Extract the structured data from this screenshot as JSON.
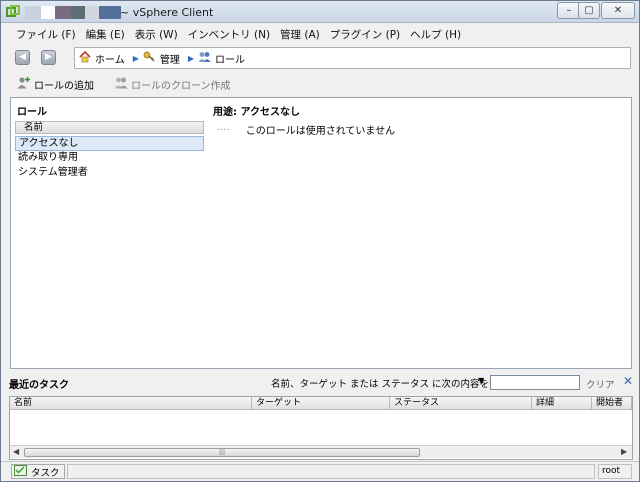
{
  "window": {
    "title": "~ vSphere Client",
    "redacted_colors": [
      "#c7d2de",
      "#ffffff",
      "#7a6a82",
      "#5e6e76",
      "#d3d6dc",
      "#556f9b"
    ]
  },
  "menu": {
    "items": [
      {
        "label": "ファイル (F)"
      },
      {
        "label": "編集 (E)"
      },
      {
        "label": "表示 (W)"
      },
      {
        "label": "インベントリ (N)"
      },
      {
        "label": "管理 (A)"
      },
      {
        "label": "プラグイン (P)"
      },
      {
        "label": "ヘルプ (H)"
      }
    ]
  },
  "breadcrumb": {
    "home": "ホーム",
    "admin": "管理",
    "roles": "ロール"
  },
  "toolbar": {
    "add_role": "ロールの追加",
    "clone_role": "ロールのクローン作成"
  },
  "roles_panel": {
    "title": "ロール",
    "column_name": "名前",
    "items": [
      {
        "label": "アクセスなし",
        "selected": true
      },
      {
        "label": "読み取り専用",
        "selected": false
      },
      {
        "label": "システム管理者",
        "selected": false
      }
    ]
  },
  "usage_panel": {
    "title": "用途: アクセスなし",
    "dots": "....",
    "message": "このロールは使用されていません"
  },
  "recent_tasks": {
    "title": "最近のタスク",
    "filter_label": "名前、ターゲット または ステータス に次の内容を含む:",
    "filter_value": "",
    "clear_label": "クリア",
    "columns": [
      "名前",
      "ターゲット",
      "ステータス",
      "詳細",
      "開始者"
    ]
  },
  "statusbar": {
    "tasks_label": "タスク",
    "user": "root"
  }
}
